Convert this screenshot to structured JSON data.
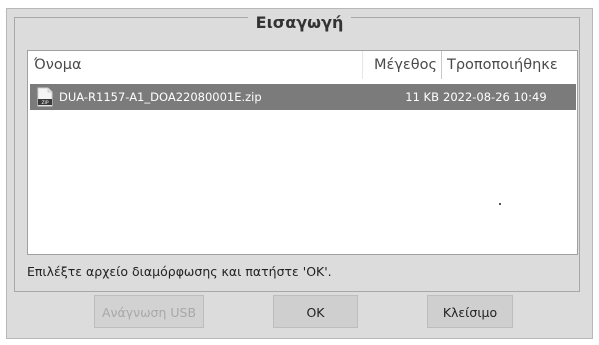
{
  "dialog": {
    "title": "Εισαγωγή"
  },
  "file_list": {
    "columns": {
      "name": "Όνομα",
      "size": "Μέγεθος",
      "modified": "Τροποποιήθηκε"
    },
    "rows": [
      {
        "icon": "zip-file-icon",
        "name": "DUA-R1157-A1_DOA22080001E.zip",
        "size": "11 KB",
        "modified": "2022-08-26 10:49",
        "selected": true
      }
    ]
  },
  "status_text": "Επιλέξτε αρχείο διαμόρφωσης και πατήστε 'OK'.",
  "buttons": {
    "usb": "Ανάγνωση USB",
    "ok": "OK",
    "close": "Κλείσιμο"
  },
  "colors": {
    "dialog_bg": "#dcdcdc",
    "selection_bg": "#7b7b7b",
    "disabled_text": "#a8a8a8"
  }
}
